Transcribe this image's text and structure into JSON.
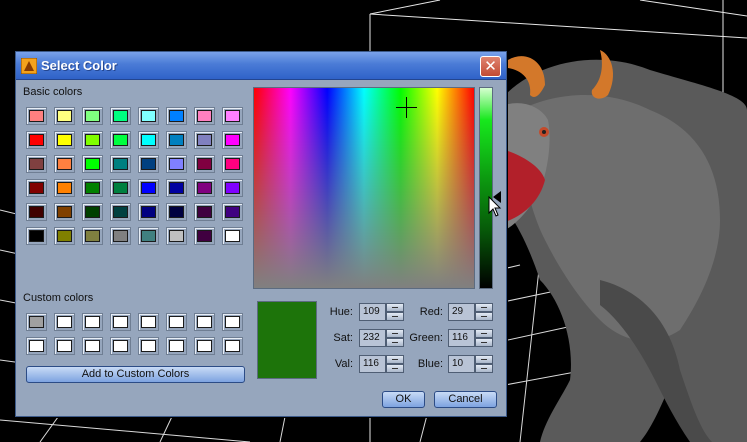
{
  "dialog": {
    "title": "Select Color",
    "close_glyph": "✕",
    "basic_colors_label": "Basic colors",
    "custom_colors_label": "Custom colors",
    "add_custom_label": "Add to Custom Colors",
    "ok_label": "OK",
    "cancel_label": "Cancel"
  },
  "basic_colors": [
    [
      "#ff8080",
      "#ffff80",
      "#80ff80",
      "#00ff80",
      "#80ffff",
      "#0080ff",
      "#ff80c0",
      "#ff80ff"
    ],
    [
      "#ff0000",
      "#ffff00",
      "#80ff00",
      "#00ff40",
      "#00ffff",
      "#0080c0",
      "#8080c0",
      "#ff00ff"
    ],
    [
      "#804040",
      "#ff8040",
      "#00ff00",
      "#008080",
      "#004080",
      "#8080ff",
      "#800040",
      "#ff0080"
    ],
    [
      "#800000",
      "#ff8000",
      "#008000",
      "#008040",
      "#0000ff",
      "#0000a0",
      "#800080",
      "#8000ff"
    ],
    [
      "#400000",
      "#804000",
      "#004000",
      "#004040",
      "#000080",
      "#000040",
      "#400040",
      "#400080"
    ],
    [
      "#000000",
      "#808000",
      "#808040",
      "#808080",
      "#408080",
      "#c0c0c0",
      "#400040",
      "#ffffff"
    ]
  ],
  "custom_colors": [
    [
      "#a0a0a0",
      "#ffffff",
      "#ffffff",
      "#ffffff",
      "#ffffff",
      "#ffffff",
      "#ffffff",
      "#ffffff"
    ],
    [
      "#ffffff",
      "#ffffff",
      "#ffffff",
      "#ffffff",
      "#ffffff",
      "#ffffff",
      "#ffffff",
      "#ffffff"
    ]
  ],
  "fields": {
    "hue_label": "Hue:",
    "hue": "109",
    "sat_label": "Sat:",
    "sat": "232",
    "val_label": "Val:",
    "val": "116",
    "red_label": "Red:",
    "red": "29",
    "green_label": "Green:",
    "green": "116",
    "blue_label": "Blue:",
    "blue": "10"
  },
  "current_color": "#1d740a",
  "luminance_fraction": 0.545,
  "icons": {
    "title": "app-icon",
    "close": "close-icon",
    "cursor": "mouse-cursor-icon"
  }
}
